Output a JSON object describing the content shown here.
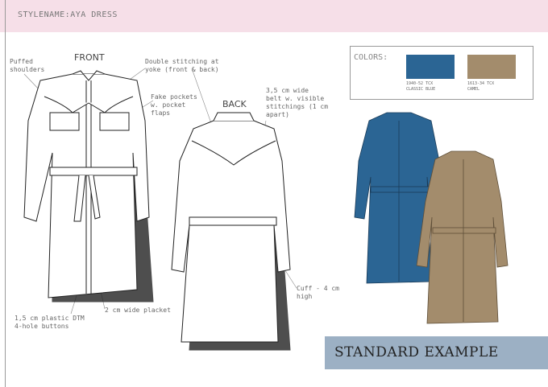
{
  "header": {
    "title": "STYLENAME:AYA DRESS"
  },
  "views": {
    "front": "FRONT",
    "back": "BACK"
  },
  "callouts": {
    "puffed": "Puffed\nshoulders",
    "stitching": "Double stitching at\nyoke (front & back)",
    "pockets": "Fake pockets\nw. pocket\nflaps",
    "belt": "3,5 cm wide\nbelt w. visible\nstitchings (1 cm\napart)",
    "cuff": "Cuff - 4 cm\nhigh",
    "placket": "2 cm wide placket",
    "buttons": "1,5 cm plastic DTM\n4-hole buttons"
  },
  "colors": {
    "title": "COLORS:",
    "items": [
      {
        "code": "1940-52 TCX",
        "name": "CLASSIC BLUE",
        "hex": "#2b6594"
      },
      {
        "code": "1613-34 TCX",
        "name": "CAMEL",
        "hex": "#a38c6c"
      }
    ]
  },
  "banner": {
    "label": "STANDARD EXAMPLE"
  }
}
